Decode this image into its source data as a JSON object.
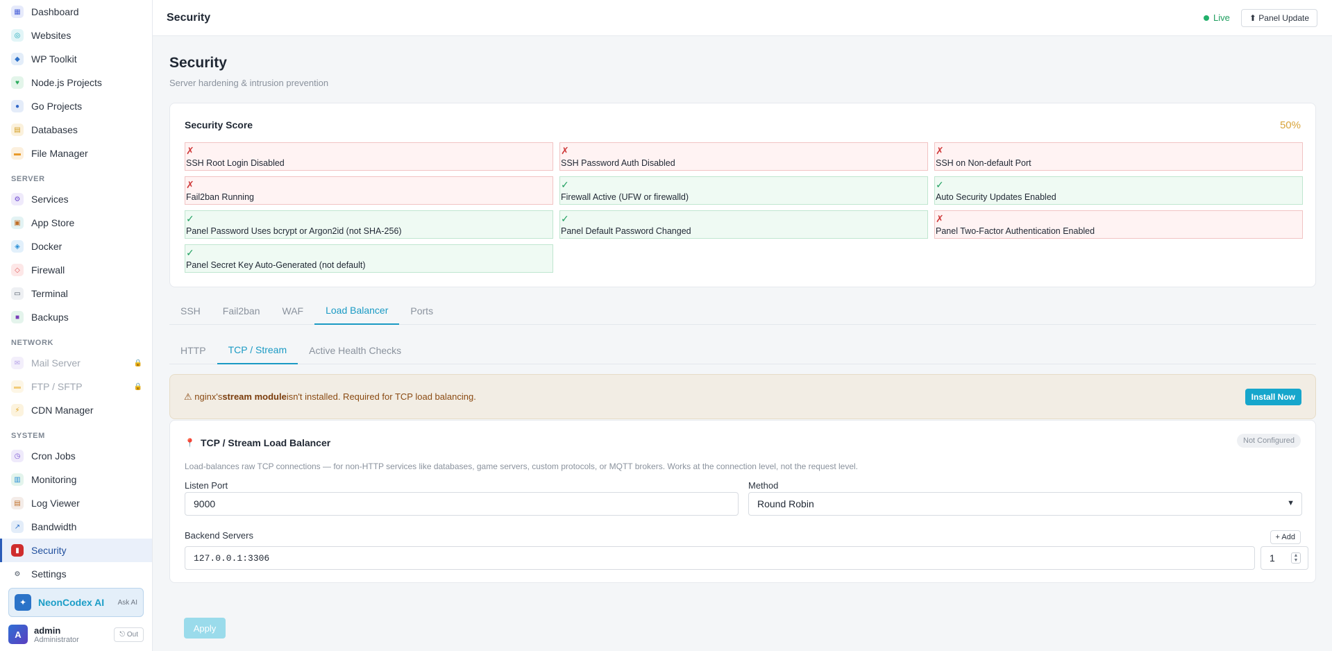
{
  "sidebar": {
    "items_top": [
      {
        "label": "Dashboard",
        "icon": "dashboard-icon",
        "glyph": "▦",
        "color": "#4a62d8",
        "bg": "#e6eafb"
      },
      {
        "label": "Websites",
        "icon": "globe-icon",
        "glyph": "◎",
        "color": "#1ba7b8",
        "bg": "#e2f5f7"
      },
      {
        "label": "WP Toolkit",
        "icon": "wordpress-icon",
        "glyph": "◆",
        "color": "#2f72c9",
        "bg": "#e3edf9"
      },
      {
        "label": "Node.js Projects",
        "icon": "nodejs-icon",
        "glyph": "♥",
        "color": "#2bab5c",
        "bg": "#e3f5ea"
      },
      {
        "label": "Go Projects",
        "icon": "go-icon",
        "glyph": "●",
        "color": "#3167c7",
        "bg": "#e4ecf9"
      },
      {
        "label": "Databases",
        "icon": "database-icon",
        "glyph": "▤",
        "color": "#d29b1c",
        "bg": "#fbf1dc"
      },
      {
        "label": "File Manager",
        "icon": "folder-icon",
        "glyph": "▬",
        "color": "#e89a2b",
        "bg": "#fcf0de"
      }
    ],
    "section_server": "SERVER",
    "items_server": [
      {
        "label": "Services",
        "icon": "services-icon",
        "glyph": "⚙",
        "color": "#6e4bd0",
        "bg": "#efeafb"
      },
      {
        "label": "App Store",
        "icon": "package-icon",
        "glyph": "▣",
        "color": "#c0702b",
        "bg": "#e3f3f4"
      },
      {
        "label": "Docker",
        "icon": "docker-icon",
        "glyph": "◈",
        "color": "#2a8fd6",
        "bg": "#e2f0fb"
      },
      {
        "label": "Firewall",
        "icon": "shield-icon",
        "glyph": "◇",
        "color": "#e05b5b",
        "bg": "#fde7e7"
      },
      {
        "label": "Terminal",
        "icon": "terminal-icon",
        "glyph": "▭",
        "color": "#4a5563",
        "bg": "#eef0f3"
      },
      {
        "label": "Backups",
        "icon": "save-icon",
        "glyph": "■",
        "color": "#7a3fb8",
        "bg": "#e4f4ec"
      }
    ],
    "section_network": "NETWORK",
    "items_network": [
      {
        "label": "Mail Server",
        "icon": "mail-icon",
        "glyph": "✉",
        "color": "#b8a5e8",
        "bg": "#f3effb",
        "locked": true
      },
      {
        "label": "FTP / SFTP",
        "icon": "ftp-icon",
        "glyph": "▬",
        "color": "#f2cc7a",
        "bg": "#fdf6e6",
        "locked": true
      },
      {
        "label": "CDN Manager",
        "icon": "lightning-icon",
        "glyph": "⚡",
        "color": "#e0a21d",
        "bg": "#fcf3de",
        "locked": false
      }
    ],
    "section_system": "SYSTEM",
    "items_system": [
      {
        "label": "Cron Jobs",
        "icon": "clock-icon",
        "glyph": "◷",
        "color": "#7a55d2",
        "bg": "#efeafb"
      },
      {
        "label": "Monitoring",
        "icon": "chart-icon",
        "glyph": "▥",
        "color": "#2a8fd6",
        "bg": "#e3f4ec"
      },
      {
        "label": "Log Viewer",
        "icon": "log-icon",
        "glyph": "▤",
        "color": "#c0702b",
        "bg": "#f4ece8"
      },
      {
        "label": "Bandwidth",
        "icon": "bandwidth-icon",
        "glyph": "↗",
        "color": "#2f72c9",
        "bg": "#e3edf9"
      },
      {
        "label": "Security",
        "icon": "lock-icon",
        "glyph": "▮",
        "color": "#ffffff",
        "bg": "#cf2d2d",
        "active": true
      },
      {
        "label": "Settings",
        "icon": "gear-icon",
        "glyph": "⚙",
        "color": "#4a5563",
        "bg": "#ffffff"
      }
    ],
    "lock_glyph": "🔒",
    "ai": {
      "name": "NeonCodex AI",
      "ask": "Ask AI",
      "glyph": "✦"
    },
    "user": {
      "initial": "A",
      "name": "admin",
      "role": "Administrator",
      "out": "⎋ Out"
    }
  },
  "header": {
    "title": "Security",
    "live": "Live",
    "panel_update": "⬆ Panel Update"
  },
  "page": {
    "title": "Security",
    "subtitle": "Server hardening & intrusion prevention"
  },
  "score": {
    "title": "Security Score",
    "value": "50%",
    "checks": [
      {
        "label": "SSH Root Login Disabled",
        "ok": false
      },
      {
        "label": "SSH Password Auth Disabled",
        "ok": false
      },
      {
        "label": "SSH on Non-default Port",
        "ok": false
      },
      {
        "label": "Fail2ban Running",
        "ok": false
      },
      {
        "label": "Firewall Active (UFW or firewalld)",
        "ok": true
      },
      {
        "label": "Auto Security Updates Enabled",
        "ok": true
      },
      {
        "label": "Panel Password Uses bcrypt or Argon2id (not SHA-256)",
        "ok": true
      },
      {
        "label": "Panel Default Password Changed",
        "ok": true
      },
      {
        "label": "Panel Two-Factor Authentication Enabled",
        "ok": false
      },
      {
        "label": "Panel Secret Key Auto-Generated (not default)",
        "ok": true
      }
    ],
    "ok_glyph": "✓",
    "fail_glyph": "✗"
  },
  "tabs_main": [
    {
      "label": "SSH",
      "active": false
    },
    {
      "label": "Fail2ban",
      "active": false
    },
    {
      "label": "WAF",
      "active": false
    },
    {
      "label": "Load Balancer",
      "active": true
    },
    {
      "label": "Ports",
      "active": false
    }
  ],
  "tabs_lb": [
    {
      "label": "HTTP",
      "active": false
    },
    {
      "label": "TCP / Stream",
      "active": true
    },
    {
      "label": "Active Health Checks",
      "active": false
    }
  ],
  "warning": {
    "prefix": "⚠ nginx's ",
    "bold": "stream module",
    "suffix": " isn't installed. Required for TCP load balancing.",
    "button": "Install Now"
  },
  "lb": {
    "pin_glyph": "📍",
    "title": "TCP / Stream Load Balancer",
    "status": "Not Configured",
    "description": "Load-balances raw TCP connections — for non-HTTP services like databases, game servers, custom protocols, or MQTT brokers. Works at the connection level, not the request level.",
    "listen_port_label": "Listen Port",
    "listen_port_value": "9000",
    "method_label": "Method",
    "method_value": "Round Robin",
    "backend_label": "Backend Servers",
    "add_label": "+ Add",
    "backend_value": "127.0.0.1:3306",
    "weight_value": "1",
    "apply_label": "Apply"
  },
  "colors": {
    "accent": "#1a9ac4",
    "ok": "#1d9e5e",
    "fail": "#cf3a3a",
    "score": "#d9a43a"
  }
}
